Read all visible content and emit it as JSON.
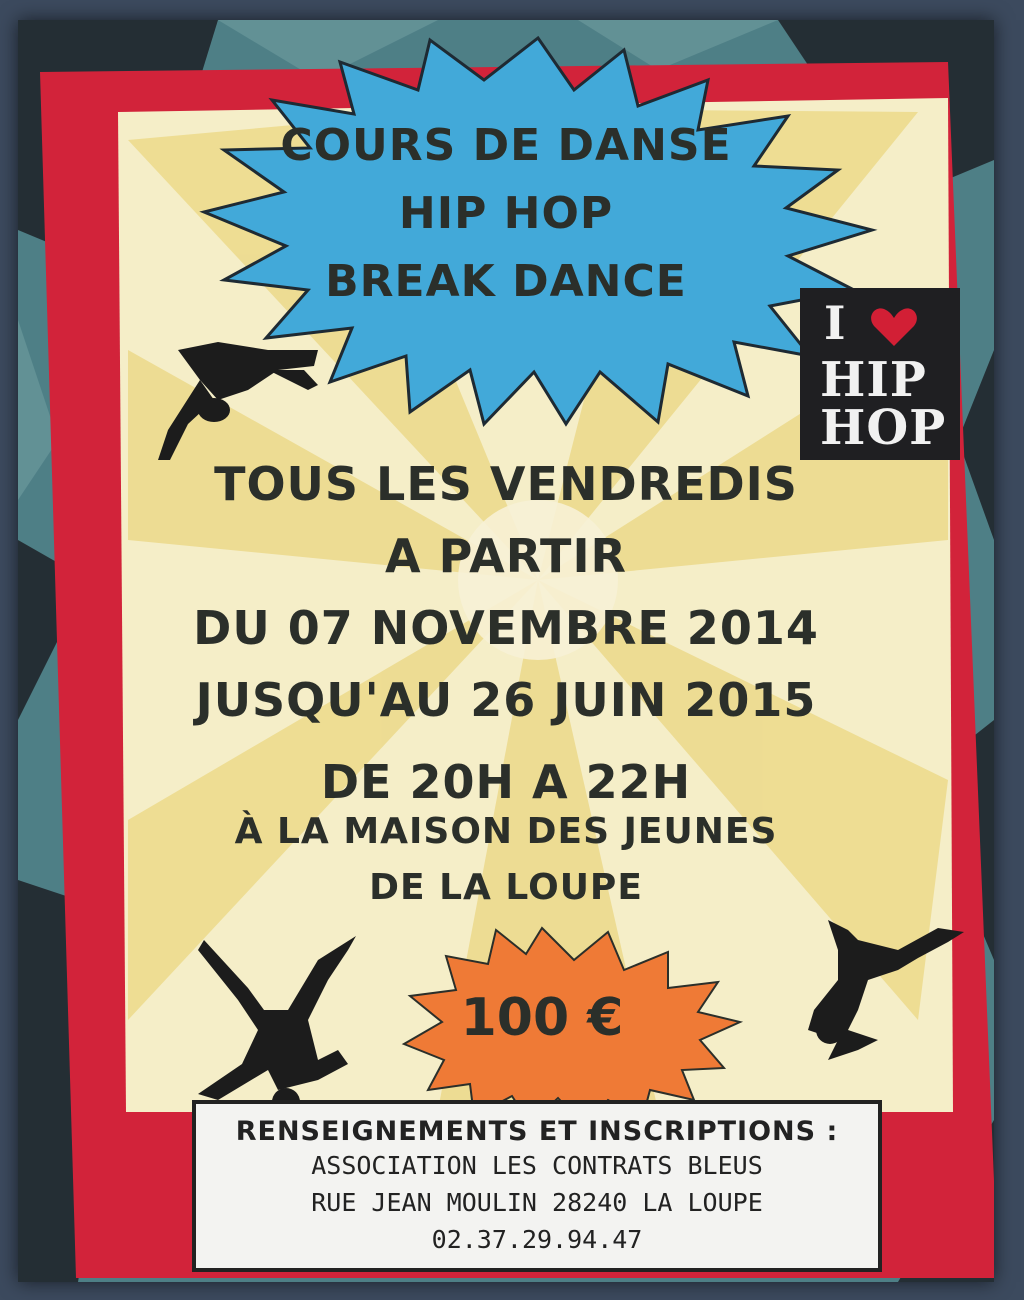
{
  "poster": {
    "title_lines": [
      "COURS DE DANSE",
      "HIP HOP",
      "BREAK DANCE"
    ],
    "badge": {
      "i": "I",
      "heart_icon": "heart-icon",
      "hip": "HIP",
      "hop": "HOP"
    },
    "schedule_lines": [
      "TOUS LES VENDREDIS",
      "A PARTIR",
      "DU 07 NOVEMBRE 2014",
      "JUSQU'AU 26 JUIN 2015"
    ],
    "time": "DE 20H A 22H",
    "place_lines": [
      "À LA MAISON DES JEUNES",
      "DE LA LOUPE"
    ],
    "price": "100 €",
    "info": {
      "heading": "RENSEIGNEMENTS ET INSCRIPTIONS :",
      "lines": [
        "ASSOCIATION LES CONTRATS BLEUS",
        "RUE JEAN MOULIN 28240 LA LOUPE",
        "02.37.29.94.47"
      ]
    },
    "colors": {
      "star_blue": "#42a9d9",
      "red_frame": "#d2233a",
      "cream": "#f5eec8",
      "yellow_swirl": "#ecd98a",
      "teal": "#4e7f86",
      "orange_burst": "#ef7a36",
      "text_dark": "#2b2f2a"
    }
  }
}
